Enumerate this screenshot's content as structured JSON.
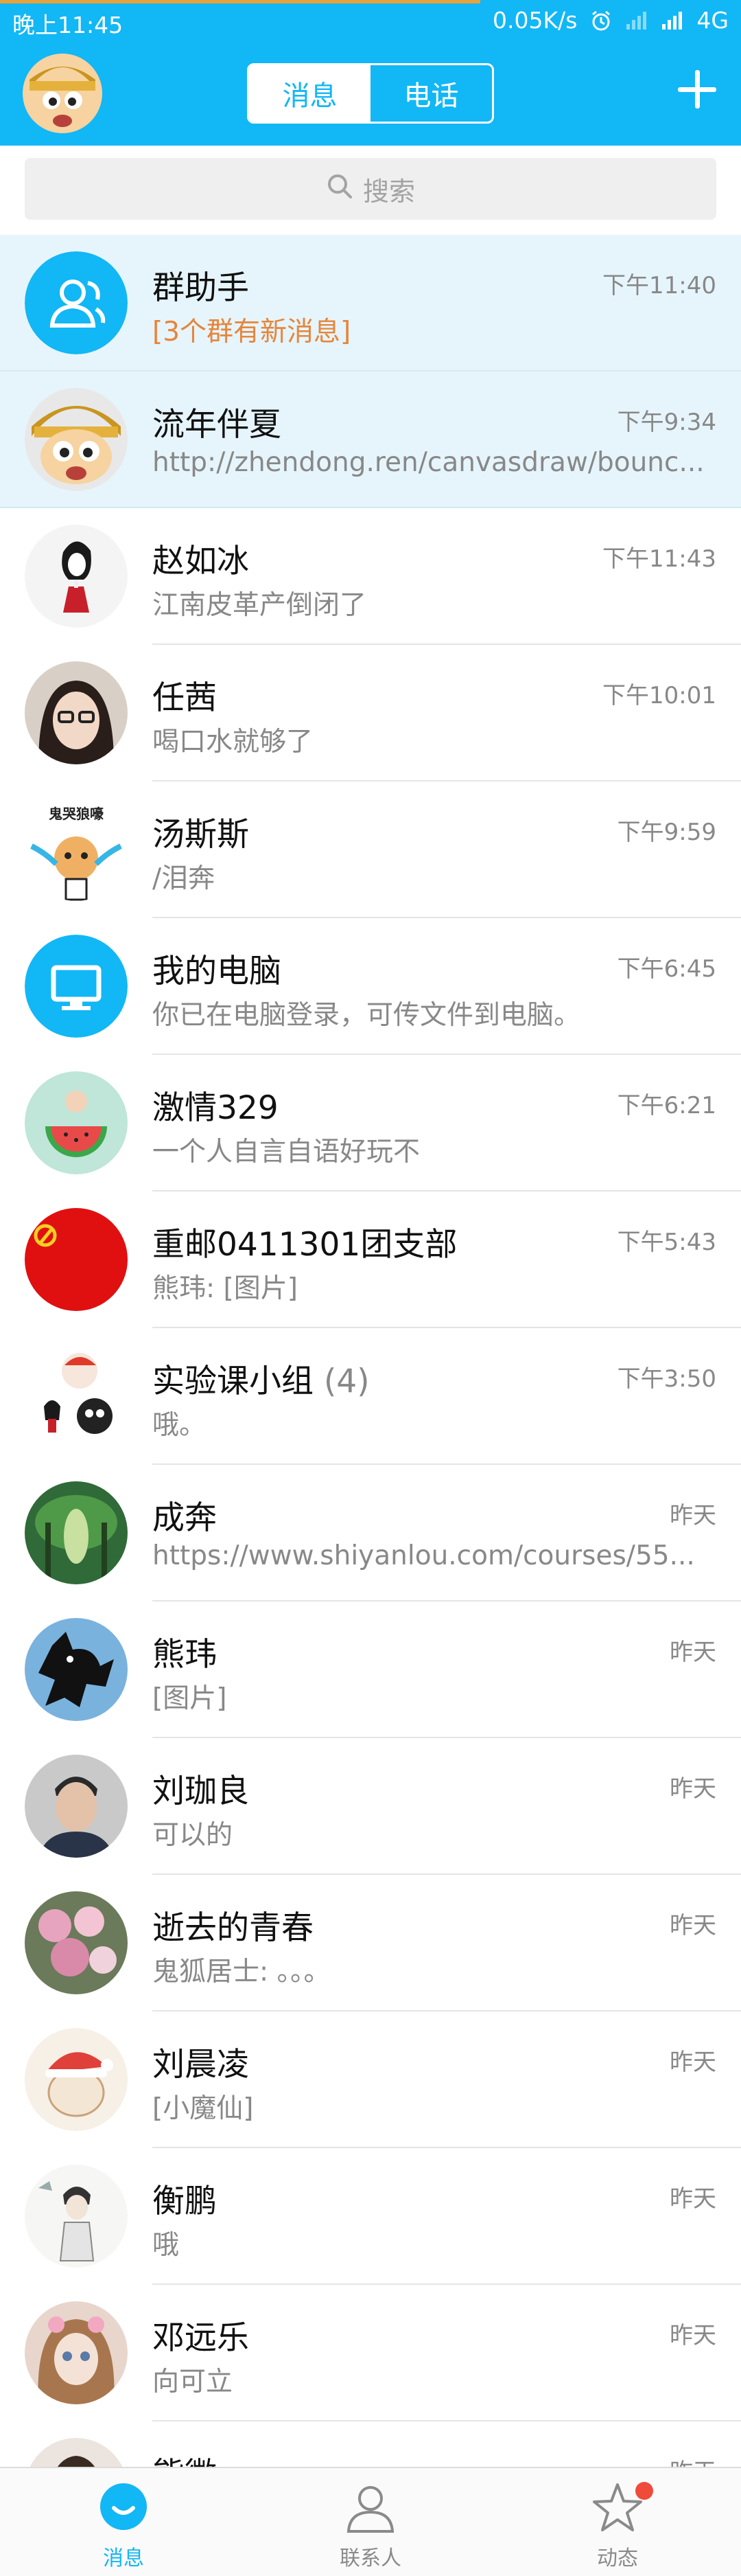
{
  "status_bar": {
    "time": "晚上11:45",
    "network_speed": "0.05K/s",
    "network_type": "4G"
  },
  "header": {
    "tabs": [
      {
        "label": "消息",
        "active": true
      },
      {
        "label": "电话",
        "active": false
      }
    ]
  },
  "search": {
    "placeholder": "搜索"
  },
  "conversations": [
    {
      "name": "群助手",
      "preview": "[3个群有新消息]",
      "time": "下午11:40"
    },
    {
      "name": "流年伴夏",
      "preview": "http://zhendong.ren/canvasdraw/bounc...",
      "time": "下午9:34"
    },
    {
      "name": "赵如冰",
      "preview": "江南皮革产倒闭了",
      "time": "下午11:43"
    },
    {
      "name": "任茜",
      "preview": "喝口水就够了",
      "time": "下午10:01"
    },
    {
      "name": "汤斯斯",
      "preview": "/泪奔",
      "time": "下午9:59",
      "avatar_text": "鬼哭狼嚎"
    },
    {
      "name": "我的电脑",
      "preview": "你已在电脑登录，可传文件到电脑。",
      "time": "下午6:45"
    },
    {
      "name": "激情329",
      "preview": "一个人自言自语好玩不",
      "time": "下午6:21"
    },
    {
      "name": "重邮0411301团支部",
      "preview": "熊玮: [图片]",
      "time": "下午5:43"
    },
    {
      "name": "实验课小组",
      "count": "(4)",
      "preview": "哦。",
      "time": "下午3:50"
    },
    {
      "name": "成奔",
      "preview": "https://www.shiyanlou.com/courses/55...",
      "time": "昨天"
    },
    {
      "name": "熊玮",
      "preview": "[图片]",
      "time": "昨天"
    },
    {
      "name": "刘珈良",
      "preview": "可以的",
      "time": "昨天"
    },
    {
      "name": "逝去的青春",
      "preview": "鬼狐居士: 。。。",
      "time": "昨天"
    },
    {
      "name": "刘晨凌",
      "preview": "[小魔仙]",
      "time": "昨天"
    },
    {
      "name": "衡鹏",
      "preview": "哦",
      "time": "昨天"
    },
    {
      "name": "邓远乐",
      "preview": "向可立",
      "time": "昨天"
    },
    {
      "name": "熊徽",
      "preview": "",
      "time": "昨天"
    }
  ],
  "tabbar": [
    {
      "label": "消息",
      "icon": "chat-bubble-icon",
      "active": true
    },
    {
      "label": "联系人",
      "icon": "person-icon",
      "active": false
    },
    {
      "label": "动态",
      "icon": "star-icon",
      "active": false,
      "badge": true
    }
  ],
  "colors": {
    "brand": "#12b7f5",
    "alert": "#e8853a",
    "badge": "#f04a3a"
  }
}
